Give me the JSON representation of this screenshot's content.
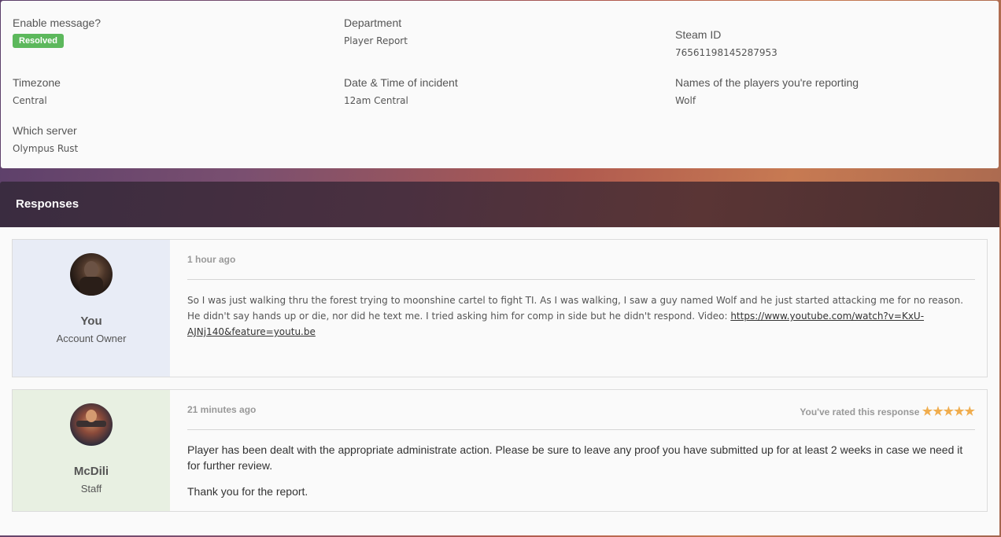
{
  "ticket": {
    "fields": {
      "enable_message": {
        "label": "Enable message?",
        "badge": "Resolved",
        "badge_color": "#5cb85c"
      },
      "department": {
        "label": "Department",
        "value": "Player Report"
      },
      "steam_id": {
        "label": "Steam ID",
        "value": "76561198145287953"
      },
      "timezone": {
        "label": "Timezone",
        "value": "Central"
      },
      "incident_time": {
        "label": "Date & Time of incident",
        "value": "12am Central"
      },
      "players": {
        "label": "Names of the players you're reporting",
        "value": "Wolf"
      },
      "server": {
        "label": "Which server",
        "value": "Olympus Rust"
      }
    }
  },
  "responses": {
    "title": "Responses",
    "items": [
      {
        "author": "You",
        "role": "Account Owner",
        "role_bg": "#e8ecf6",
        "time": "1 hour ago",
        "text": "So I was just walking thru the forest trying to moonshine cartel to fight TI. As I was walking, I saw a guy named Wolf and he just started attacking me for no reason. He didn't say hands up or die, nor did he text me. I tried asking him for comp in side but he didn't respond. Video: ",
        "link": "https://www.youtube.com/watch?v=KxU-AJNj140&feature=youtu.be"
      },
      {
        "author": "McDili",
        "role": "Staff",
        "role_bg": "#e8f0e2",
        "time": "21 minutes ago",
        "rating_label": "You've rated this response",
        "rating": 5,
        "star_icon": "★",
        "star_color": "#f0ad4e",
        "paragraphs": [
          "Player has been dealt with the appropriate administrate action. Please be sure to leave any proof you have submitted up for at least 2 weeks in case we need it for further review.",
          "Thank you for the report."
        ]
      }
    ]
  }
}
